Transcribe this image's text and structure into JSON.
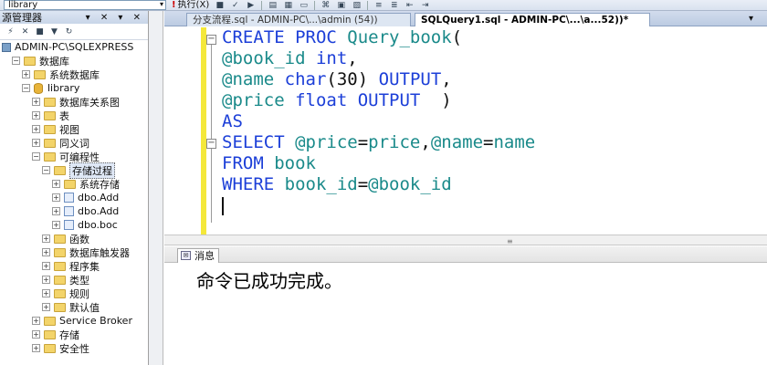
{
  "toolbar": {
    "database": "library",
    "execute_label": "执行(X)",
    "icons": [
      "execute-icon",
      "stop-icon",
      "parse-icon",
      "debug-icon",
      "results-icon",
      "grid-icon",
      "file-icon",
      "plan-icon",
      "stats-icon",
      "client-icon",
      "indent-icon",
      "outdent-icon",
      "comment-icon",
      "uncomment-icon"
    ]
  },
  "explorer": {
    "title": "源管理器",
    "pins": "▾ ✕ ▾ ✕",
    "items": [
      {
        "label": "ADMIN-PC\\SQLEXPRESS",
        "indent": 0,
        "expander": "",
        "icon": "server"
      },
      {
        "label": "数据库",
        "indent": 1,
        "expander": "−",
        "icon": "folder"
      },
      {
        "label": "系统数据库",
        "indent": 2,
        "expander": "+",
        "icon": "folder"
      },
      {
        "label": "library",
        "indent": 2,
        "expander": "−",
        "icon": "db"
      },
      {
        "label": "数据库关系图",
        "indent": 3,
        "expander": "+",
        "icon": "folder"
      },
      {
        "label": "表",
        "indent": 3,
        "expander": "+",
        "icon": "folder"
      },
      {
        "label": "视图",
        "indent": 3,
        "expander": "+",
        "icon": "folder"
      },
      {
        "label": "同义词",
        "indent": 3,
        "expander": "+",
        "icon": "folder"
      },
      {
        "label": "可编程性",
        "indent": 3,
        "expander": "−",
        "icon": "folder"
      },
      {
        "label": "存储过程",
        "indent": 4,
        "expander": "−",
        "icon": "folder",
        "selected": true
      },
      {
        "label": "系统存储",
        "indent": 5,
        "expander": "+",
        "icon": "folder"
      },
      {
        "label": "dbo.Add",
        "indent": 5,
        "expander": "+",
        "icon": "proc"
      },
      {
        "label": "dbo.Add",
        "indent": 5,
        "expander": "+",
        "icon": "proc"
      },
      {
        "label": "dbo.boc",
        "indent": 5,
        "expander": "+",
        "icon": "proc"
      },
      {
        "label": "函数",
        "indent": 4,
        "expander": "+",
        "icon": "folder"
      },
      {
        "label": "数据库触发器",
        "indent": 4,
        "expander": "+",
        "icon": "folder"
      },
      {
        "label": "程序集",
        "indent": 4,
        "expander": "+",
        "icon": "folder"
      },
      {
        "label": "类型",
        "indent": 4,
        "expander": "+",
        "icon": "folder"
      },
      {
        "label": "规则",
        "indent": 4,
        "expander": "+",
        "icon": "folder"
      },
      {
        "label": "默认值",
        "indent": 4,
        "expander": "+",
        "icon": "folder"
      },
      {
        "label": "Service Broker",
        "indent": 3,
        "expander": "+",
        "icon": "folder"
      },
      {
        "label": "存储",
        "indent": 3,
        "expander": "+",
        "icon": "folder"
      },
      {
        "label": "安全性",
        "indent": 3,
        "expander": "+",
        "icon": "folder"
      }
    ]
  },
  "tabs": [
    {
      "label": "分支流程.sql - ADMIN-PC\\...\\admin (54))",
      "active": false
    },
    {
      "label": "SQLQuery1.sql - ADMIN-PC\\...\\a...52))*",
      "active": true
    }
  ],
  "tab_close": "▾",
  "editor": {
    "lines": [
      [
        {
          "t": "CREATE PROC ",
          "c": "kw"
        },
        {
          "t": "Query_book",
          "c": "id"
        },
        {
          "t": "(",
          "c": "plain"
        }
      ],
      [
        {
          "t": "@book_id ",
          "c": "id"
        },
        {
          "t": "int",
          "c": "kw"
        },
        {
          "t": ",",
          "c": "plain"
        }
      ],
      [
        {
          "t": "@name ",
          "c": "id"
        },
        {
          "t": "char",
          "c": "kw"
        },
        {
          "t": "(",
          "c": "plain"
        },
        {
          "t": "30",
          "c": "plain"
        },
        {
          "t": ") ",
          "c": "plain"
        },
        {
          "t": "OUTPUT",
          "c": "kw"
        },
        {
          "t": ",",
          "c": "plain"
        }
      ],
      [
        {
          "t": "@price ",
          "c": "id"
        },
        {
          "t": "float ",
          "c": "kw"
        },
        {
          "t": "OUTPUT  ",
          "c": "kw"
        },
        {
          "t": ")",
          "c": "plain"
        }
      ],
      [
        {
          "t": "AS",
          "c": "kw"
        }
      ],
      [
        {
          "t": "SELECT ",
          "c": "kw"
        },
        {
          "t": "@price",
          "c": "id"
        },
        {
          "t": "=",
          "c": "plain"
        },
        {
          "t": "price",
          "c": "id"
        },
        {
          "t": ",",
          "c": "plain"
        },
        {
          "t": "@name",
          "c": "id"
        },
        {
          "t": "=",
          "c": "plain"
        },
        {
          "t": "name",
          "c": "id"
        }
      ],
      [
        {
          "t": "FROM ",
          "c": "kw"
        },
        {
          "t": "book",
          "c": "id"
        }
      ],
      [
        {
          "t": "WHERE ",
          "c": "kw"
        },
        {
          "t": "book_id",
          "c": "id"
        },
        {
          "t": "=",
          "c": "plain"
        },
        {
          "t": "@book_id",
          "c": "id"
        }
      ]
    ]
  },
  "results": {
    "tab_label": "消息",
    "message": "命令已成功完成。"
  }
}
